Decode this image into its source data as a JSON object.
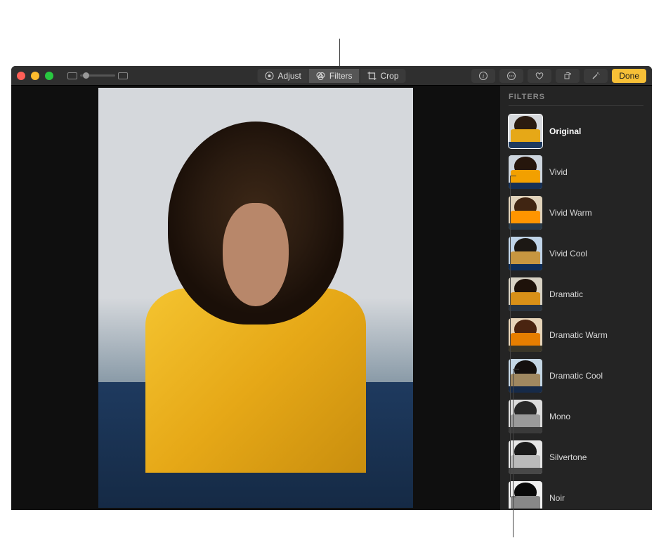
{
  "toolbar": {
    "adjust_label": "Adjust",
    "filters_label": "Filters",
    "crop_label": "Crop",
    "done_label": "Done"
  },
  "sidebar": {
    "title": "FILTERS",
    "filters": [
      {
        "label": "Original",
        "selected": true,
        "sky": "#d5d8dc",
        "hair": "#2a1b10",
        "body": "#e6a817",
        "bottom": "#1e3a5f"
      },
      {
        "label": "Vivid",
        "selected": false,
        "sky": "#cdd5de",
        "hair": "#26160c",
        "body": "#f2a000",
        "bottom": "#163055"
      },
      {
        "label": "Vivid Warm",
        "selected": false,
        "sky": "#e0d2ba",
        "hair": "#402512",
        "body": "#ff9500",
        "bottom": "#2a3a48"
      },
      {
        "label": "Vivid Cool",
        "selected": false,
        "sky": "#c0d4e8",
        "hair": "#1c1814",
        "body": "#c79640",
        "bottom": "#0e2d58"
      },
      {
        "label": "Dramatic",
        "selected": false,
        "sky": "#d8d2c4",
        "hair": "#1e120a",
        "body": "#d89018",
        "bottom": "#2a3440"
      },
      {
        "label": "Dramatic Warm",
        "selected": false,
        "sky": "#e6d4b8",
        "hair": "#4a2410",
        "body": "#e67e00",
        "bottom": "#3a3628"
      },
      {
        "label": "Dramatic Cool",
        "selected": false,
        "sky": "#c4d6e4",
        "hair": "#14100e",
        "body": "#a08860",
        "bottom": "#162a48"
      },
      {
        "label": "Mono",
        "selected": false,
        "sky": "#dcdcdc",
        "hair": "#282828",
        "body": "#9a9a9a",
        "bottom": "#3a3a3a"
      },
      {
        "label": "Silvertone",
        "selected": false,
        "sky": "#e6e6e6",
        "hair": "#1a1a1a",
        "body": "#bababa",
        "bottom": "#484848"
      },
      {
        "label": "Noir",
        "selected": false,
        "sky": "#f0f0f0",
        "hair": "#0a0a0a",
        "body": "#888888",
        "bottom": "#1a1a1a"
      }
    ]
  }
}
